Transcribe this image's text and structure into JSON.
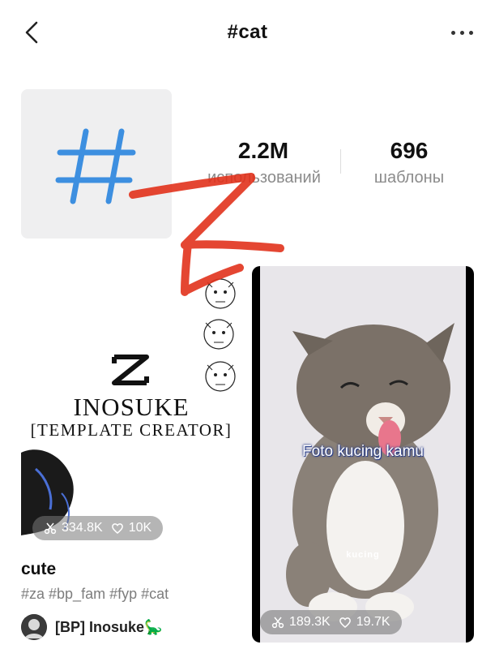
{
  "header": {
    "title": "#cat"
  },
  "stats": {
    "uses_value": "2.2M",
    "uses_label": "использований",
    "templates_value": "696",
    "templates_label": "шаблоны"
  },
  "colors": {
    "hashtag": "#3d8fe0",
    "arrow": "#e2321c",
    "overlay_text_glow": "#2b3f8a"
  },
  "cards": {
    "left": {
      "creator_name": "INOSUKE",
      "creator_role": "[TEMPLATE CREATOR]",
      "uses": "334.8K",
      "likes": "10K",
      "title": "cute",
      "tags": "#za #bp_fam #fyp #cat",
      "author": "[BP] Inosuke🦕"
    },
    "right": {
      "overlay_text": "Foto kucing kamu",
      "label": "kucing",
      "uses": "189.3K",
      "likes": "19.7K"
    }
  }
}
